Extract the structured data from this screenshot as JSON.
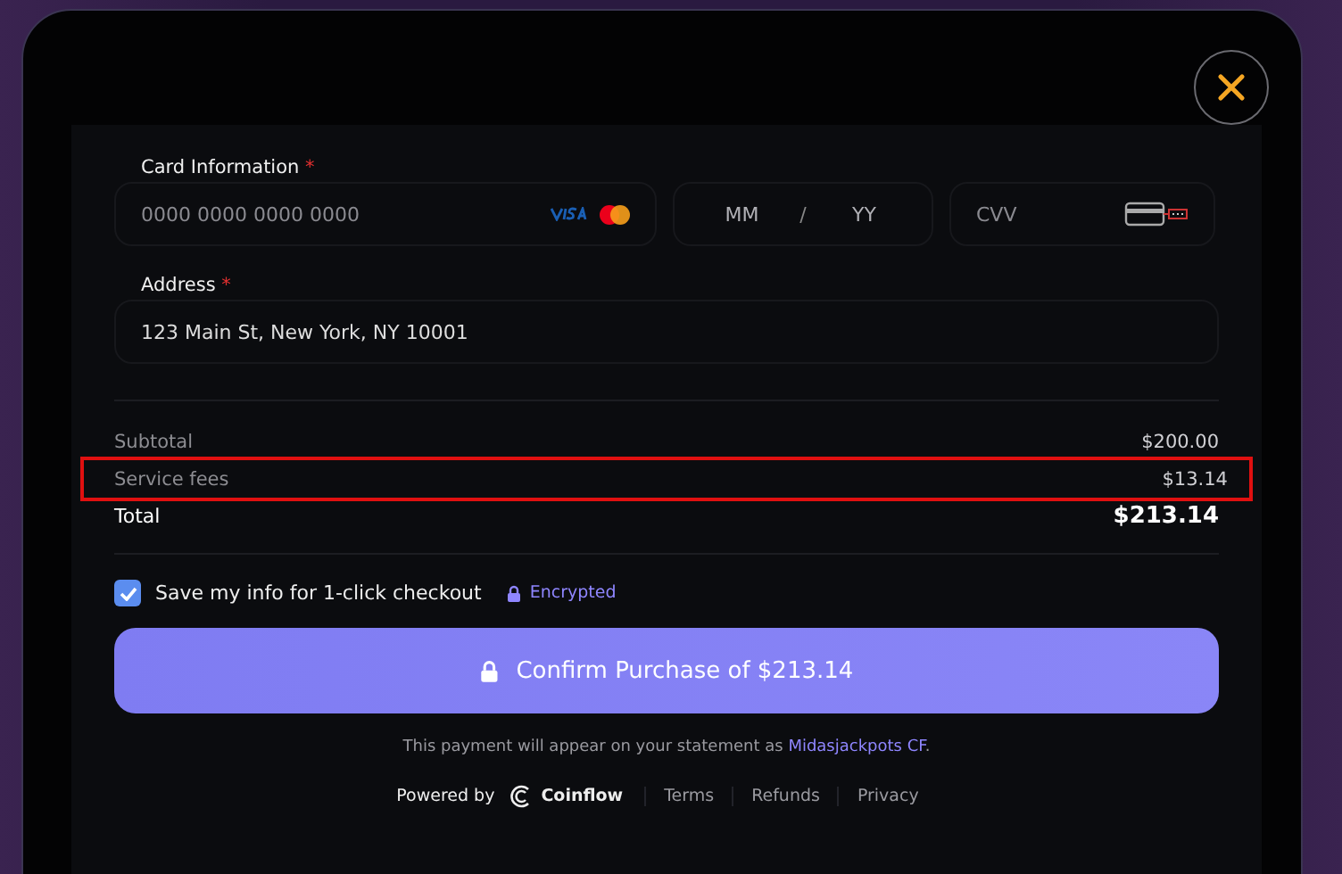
{
  "card_information": {
    "label": "Card Information",
    "required_mark": "*",
    "number_placeholder": "0000 0000 0000 0000",
    "month_placeholder": "MM",
    "separator": "/",
    "year_placeholder": "YY",
    "cvv_placeholder": "CVV"
  },
  "address": {
    "label": "Address",
    "required_mark": "*",
    "value": "123 Main St, New York, NY 10001"
  },
  "summary": [
    {
      "label": "Subtotal",
      "amount": "$200.00",
      "kind": "line",
      "highlighted": false
    },
    {
      "label": "Service fees",
      "amount": "$13.14",
      "kind": "line",
      "highlighted": true
    },
    {
      "label": "Total",
      "amount": "$213.14",
      "kind": "total",
      "highlighted": false
    }
  ],
  "save_info": {
    "label": "Save my info for 1-click checkout",
    "checked": true,
    "badge": "Encrypted"
  },
  "confirm_button": "Confirm Purchase of $213.14",
  "statement": {
    "text": "This payment will appear on your statement as",
    "merchant": "Midasjackpots CF",
    "end": "."
  },
  "footer": {
    "powered_by": "Powered by",
    "brand": "Coinflow",
    "links": [
      "Terms",
      "Refunds",
      "Privacy"
    ]
  }
}
